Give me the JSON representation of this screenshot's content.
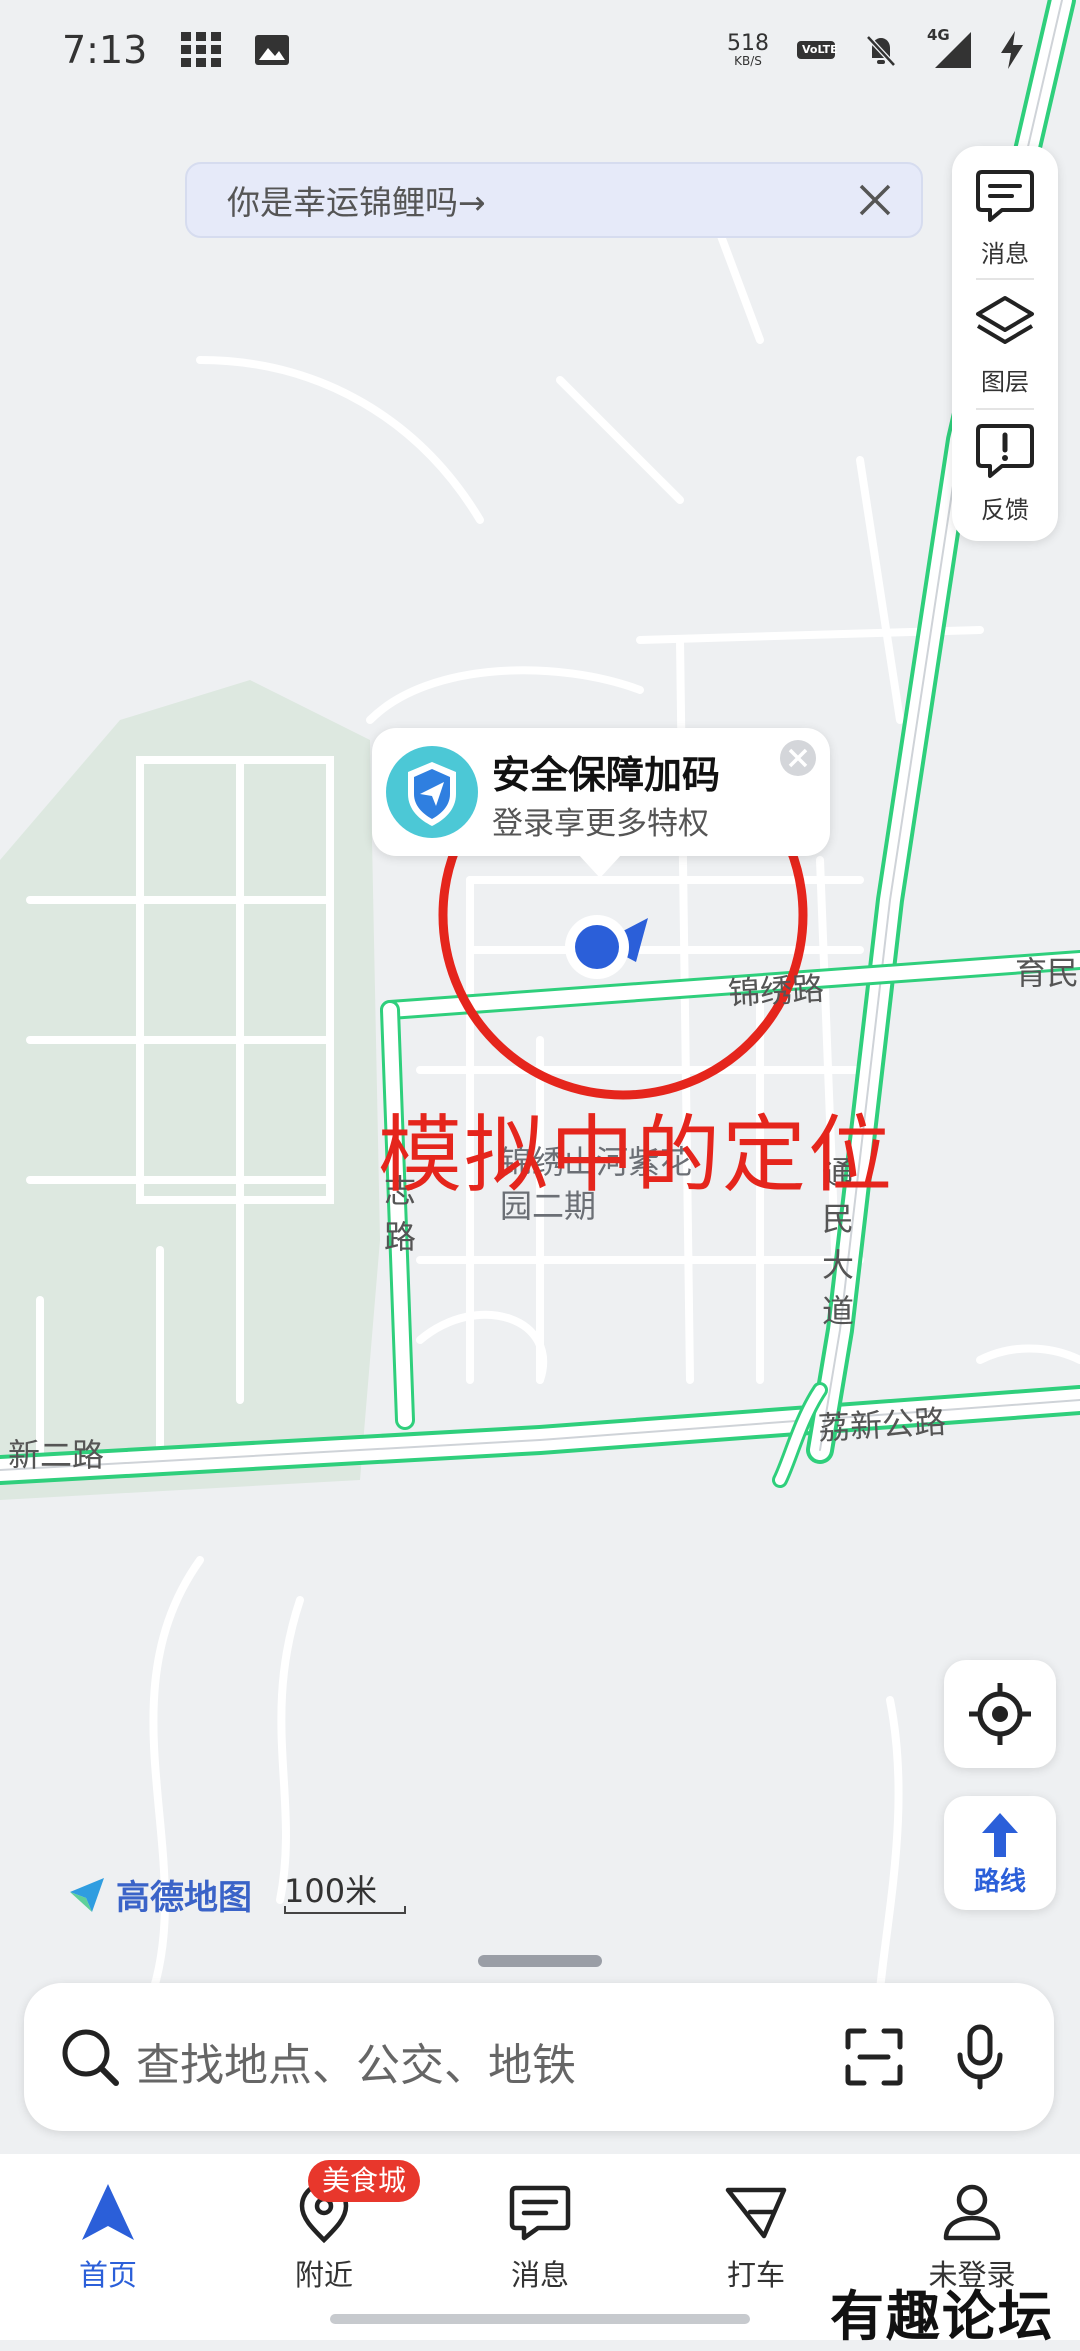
{
  "status_bar": {
    "time": "7:13",
    "speed_value": "518",
    "speed_unit": "KB/S",
    "volte": "VoLTE",
    "network": "4G"
  },
  "banner": {
    "text": "你是幸运锦鲤吗→"
  },
  "side_panel": {
    "items": [
      {
        "label": "消息",
        "icon": "message-icon"
      },
      {
        "label": "图层",
        "icon": "layers-icon"
      },
      {
        "label": "反馈",
        "icon": "feedback-icon"
      }
    ]
  },
  "popup": {
    "title": "安全保障加码",
    "subtitle": "登录享更多特权"
  },
  "annotation": {
    "text": "模拟中的定位"
  },
  "map_labels": {
    "road_jinxiu": "锦绣路",
    "road_yumin": "育民",
    "road_tongmin": "通民大道",
    "road_lixin": "荔新公路",
    "road_xin_er": "新二路",
    "road_zhi": "志路",
    "community": "锦绣山河紫花园二期"
  },
  "map_controls": {
    "route_label": "路线"
  },
  "brand": {
    "logo_text": "高德地图"
  },
  "scale": {
    "label": "100米"
  },
  "search": {
    "placeholder": "查找地点、公交、地铁"
  },
  "tabbar": {
    "tabs": [
      {
        "label": "首页",
        "icon": "navigation-arrow-icon",
        "active": true
      },
      {
        "label": "附近",
        "icon": "location-pin-icon",
        "active": false
      },
      {
        "label": "消息",
        "icon": "message-icon",
        "active": false
      },
      {
        "label": "打车",
        "icon": "taxi-icon",
        "active": false
      },
      {
        "label": "未登录",
        "icon": "user-icon",
        "active": false
      }
    ],
    "badge": "美食城"
  },
  "watermark": {
    "text": "有趣论坛"
  },
  "colors": {
    "accent": "#2b5fd9",
    "annotation_red": "#e5251c",
    "road_green": "#2fcf7c",
    "badge_red": "#e8372c",
    "map_background": "#eef0f2"
  }
}
